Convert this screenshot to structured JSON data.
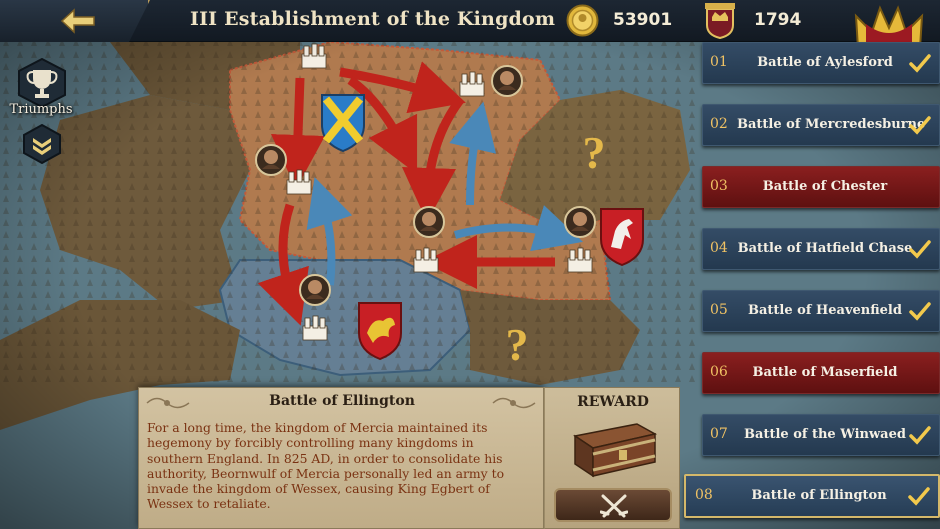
{
  "header": {
    "title": "III Establishment of the Kingdom",
    "gold": "53901",
    "fame": "1794"
  },
  "icons": {
    "back": "back-arrow-icon",
    "gold": "gold-coin-icon",
    "fame": "fame-emblem-icon",
    "crown": "crown-icon",
    "triumphs": "trophy-icon",
    "collapse": "chevron-down-icon",
    "check": "check-icon",
    "chest": "treasure-chest-icon",
    "battle": "crossed-swords-icon"
  },
  "sidebar": {
    "triumphs_label": "Triumphs"
  },
  "battles": [
    {
      "num": "01",
      "name": "Battle of Aylesford",
      "completed": true,
      "style": "blue"
    },
    {
      "num": "02",
      "name": "Battle of Mercredesburne",
      "completed": true,
      "style": "blue"
    },
    {
      "num": "03",
      "name": "Battle of Chester",
      "completed": false,
      "style": "red"
    },
    {
      "num": "04",
      "name": "Battle of Hatfield Chase",
      "completed": true,
      "style": "blue"
    },
    {
      "num": "05",
      "name": "Battle of Heavenfield",
      "completed": true,
      "style": "blue"
    },
    {
      "num": "06",
      "name": "Battle of Maserfield",
      "completed": false,
      "style": "red"
    },
    {
      "num": "07",
      "name": "Battle of the Winwaed",
      "completed": true,
      "style": "blue"
    },
    {
      "num": "08",
      "name": "Battle of Ellington",
      "completed": true,
      "style": "selected"
    }
  ],
  "info": {
    "title": "Battle of Ellington",
    "description": "For a long time, the kingdom of Mercia maintained its hegemony by forcibly controlling many kingdoms in southern England. In 825 AD, in order to consolidate his authority, Beornwulf of Mercia personally led an army to invade the kingdom of Wessex, causing King Egbert of Wessex to retaliate.",
    "reward_label": "REWARD"
  },
  "map": {
    "unknown_marker": "?",
    "colors": {
      "sea": "#5c7a86",
      "land": "#6e5a3c",
      "mercia": "#b07a4f",
      "wessex": "#657f94",
      "red_arrow": "#c0241c",
      "blue_arrow": "#4a88b8"
    }
  }
}
